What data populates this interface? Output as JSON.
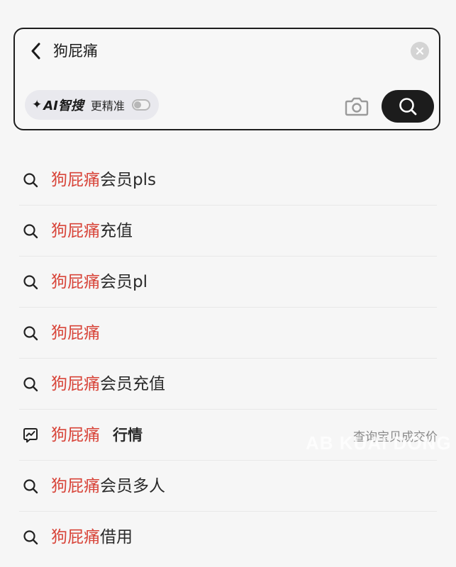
{
  "search": {
    "query": "狗屁痛",
    "ai_chip": {
      "sparkle": "✦",
      "label": "AI智搜",
      "desc": "更精准",
      "toggle_on": false
    },
    "icons": {
      "back": "chevron-left-icon",
      "clear": "close-circle-icon",
      "camera": "camera-icon",
      "search": "search-icon"
    }
  },
  "suggestions": [
    {
      "highlight": "狗屁痛",
      "rest": "会员pls",
      "icon": "search-icon"
    },
    {
      "highlight": "狗屁痛",
      "rest": "充值",
      "icon": "search-icon"
    },
    {
      "highlight": "狗屁痛",
      "rest": "会员pl",
      "icon": "search-icon"
    },
    {
      "highlight": "狗屁痛",
      "rest": "",
      "icon": "search-icon"
    },
    {
      "highlight": "狗屁痛",
      "rest": "会员充值",
      "icon": "search-icon"
    },
    {
      "highlight": "狗屁痛",
      "rest": "",
      "tag": "行情",
      "hint": "查询宝贝成交价",
      "icon": "trend-chart-icon"
    },
    {
      "highlight": "狗屁痛",
      "rest": "会员多人",
      "icon": "search-icon"
    },
    {
      "highlight": "狗屁痛",
      "rest": "借用",
      "icon": "search-icon"
    }
  ],
  "watermark": "AB KUAI DONG",
  "colors": {
    "highlight": "#d8453a",
    "search_button": "#1c1c1c",
    "background": "#f6f6f6"
  }
}
